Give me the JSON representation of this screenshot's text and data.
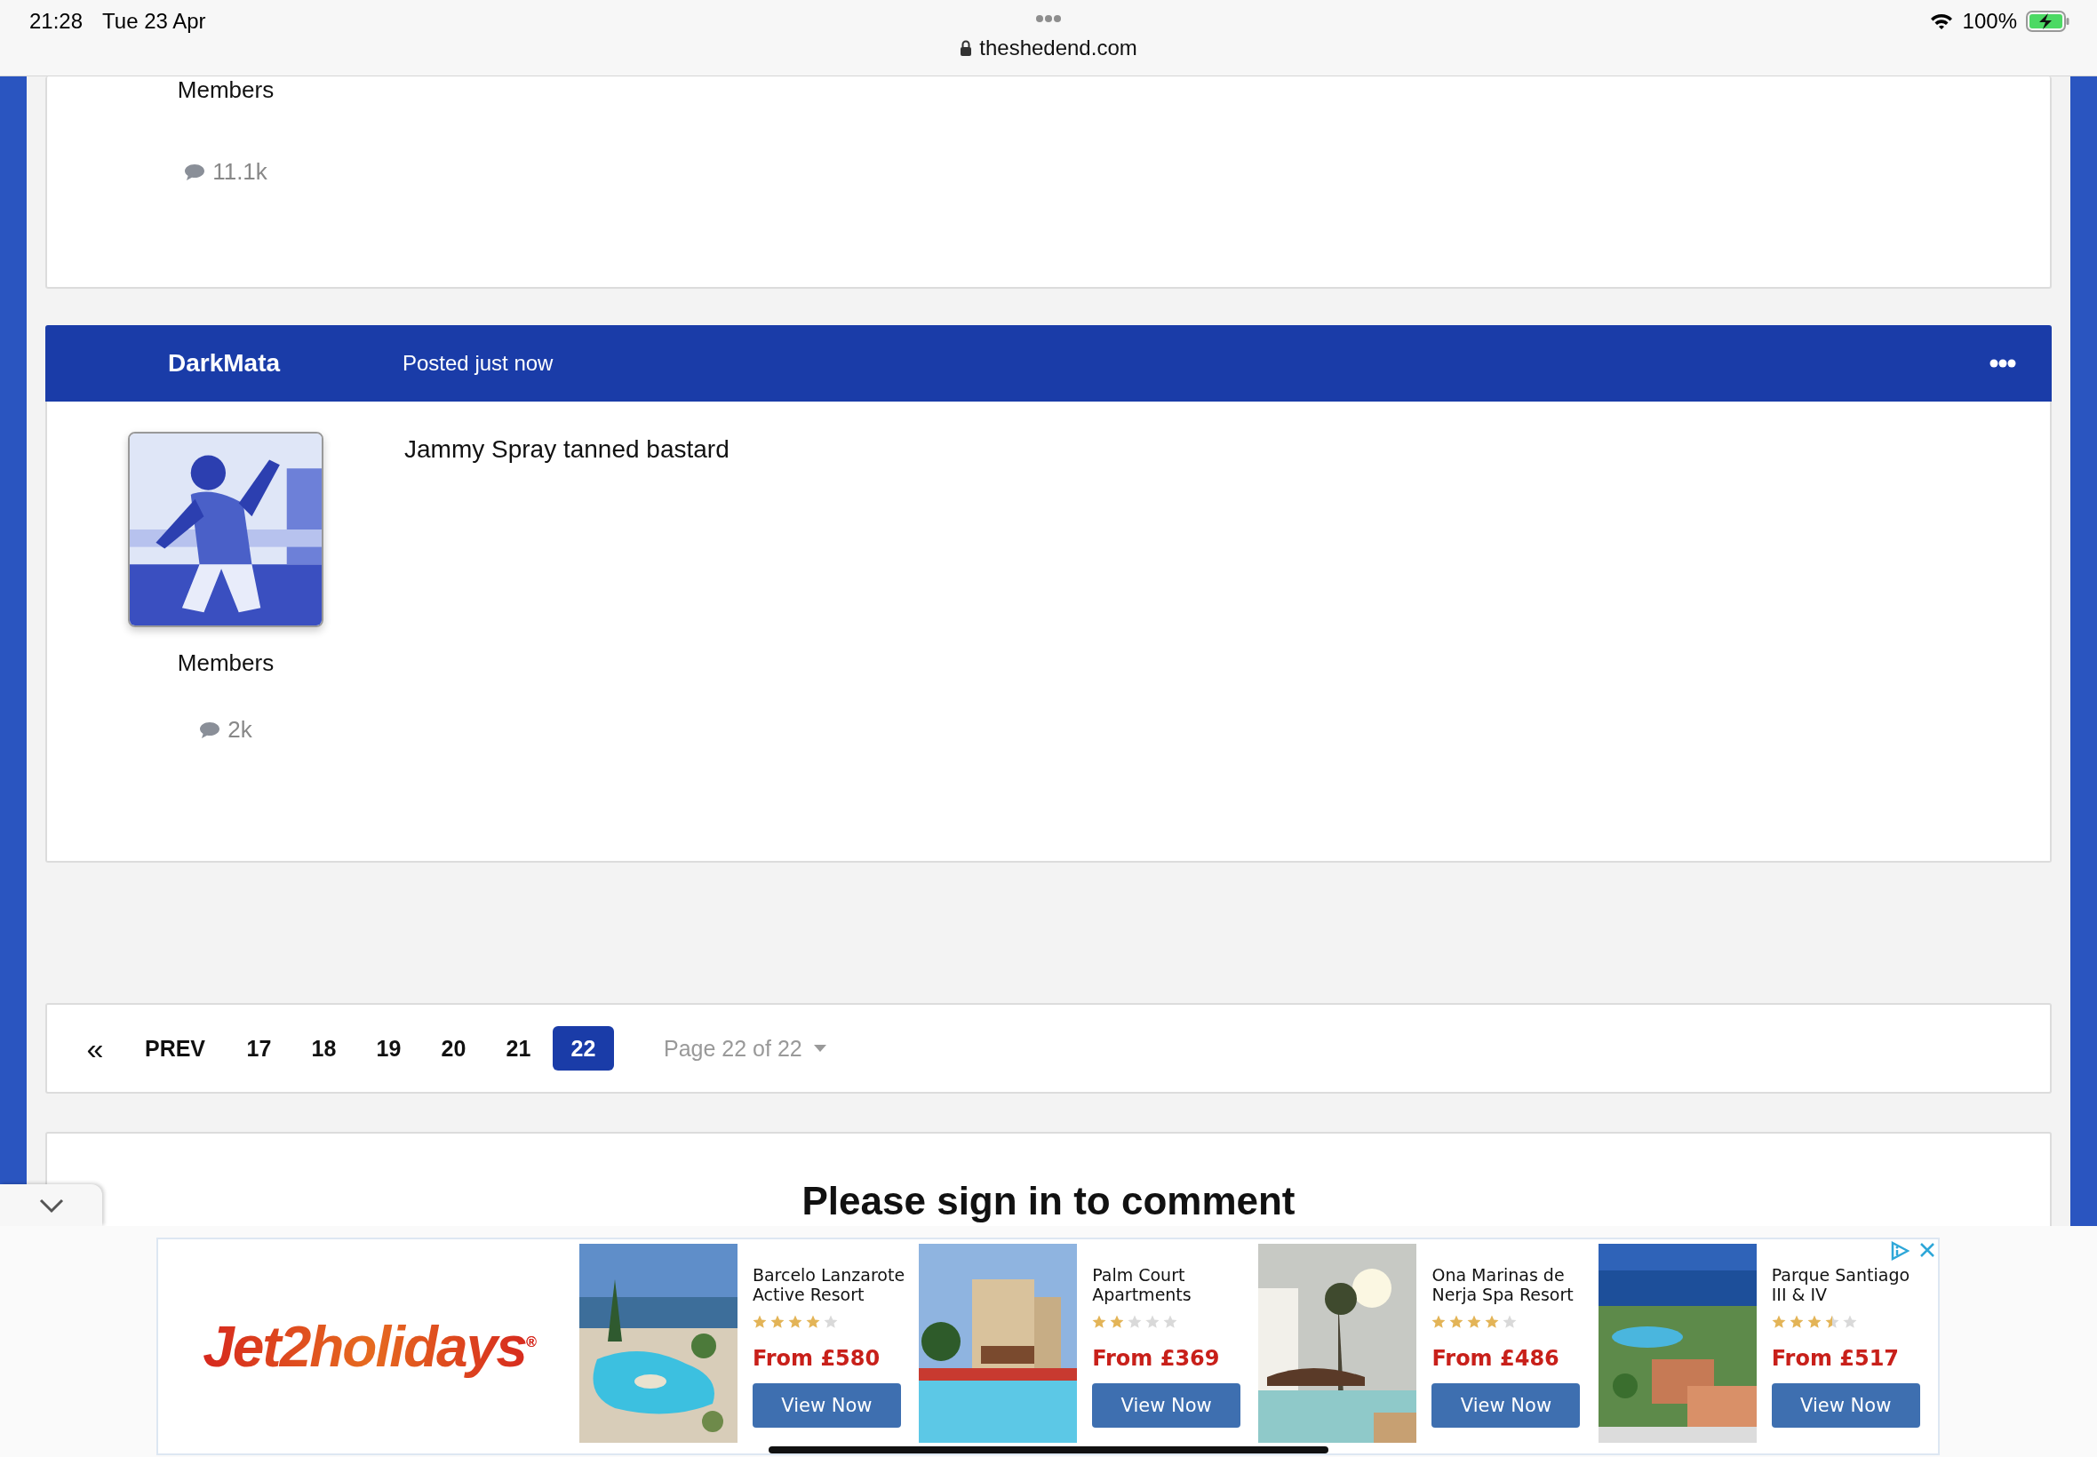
{
  "status_bar": {
    "time": "21:28",
    "date": "Tue 23 Apr",
    "battery": "100%"
  },
  "browser": {
    "url": "theshedend.com"
  },
  "previous_post": {
    "group": "Members",
    "post_count": "11.1k"
  },
  "post": {
    "author": "DarkMata",
    "posted": "Posted just now",
    "group": "Members",
    "post_count": "2k",
    "content": "Jammy Spray tanned bastard"
  },
  "pagination": {
    "first": "«",
    "prev": "PREV",
    "pages": [
      {
        "label": "17",
        "selected": false
      },
      {
        "label": "18",
        "selected": false
      },
      {
        "label": "19",
        "selected": false
      },
      {
        "label": "20",
        "selected": false
      },
      {
        "label": "21",
        "selected": false
      },
      {
        "label": "22",
        "selected": true
      }
    ],
    "page_menu": "Page 22 of 22"
  },
  "comment": {
    "heading": "Please sign in to comment"
  },
  "ad": {
    "brand": "Jet2holidays$^{®}$",
    "hotels": [
      {
        "name": "Barcelo Lanzarote Active Resort",
        "stars": 4,
        "price": "From £580",
        "button": "View Now"
      },
      {
        "name": "Palm Court Apartments",
        "stars": 2,
        "price": "From £369",
        "button": "View Now"
      },
      {
        "name": "Ona Marinas de Nerja Spa Resort",
        "stars": 4,
        "price": "From £486",
        "button": "View Now"
      },
      {
        "name": "Parque Santiago III & IV",
        "stars": 3.5,
        "price": "From £517",
        "button": "View Now"
      }
    ]
  }
}
